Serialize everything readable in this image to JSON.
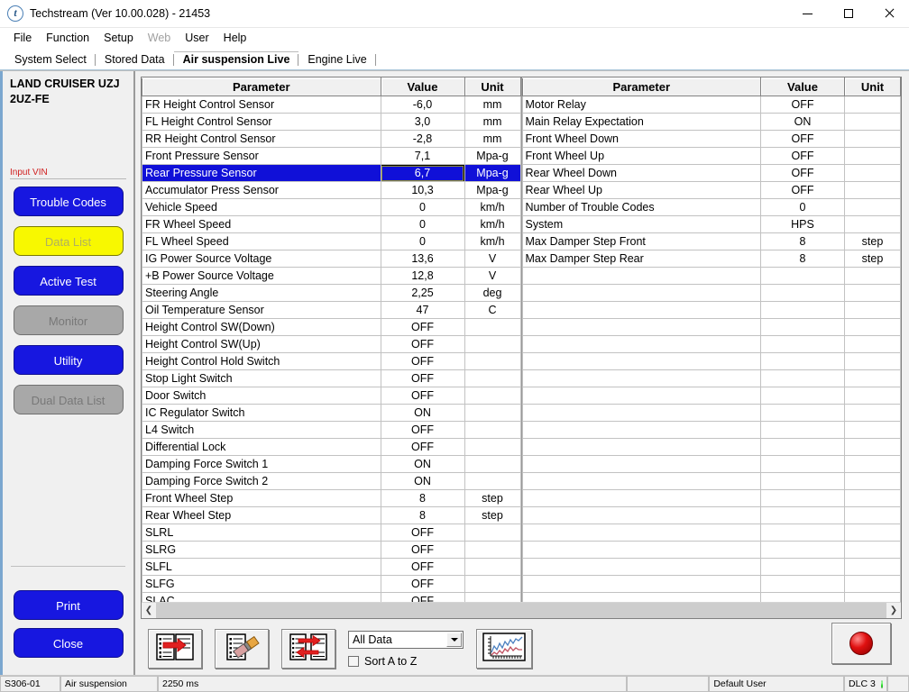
{
  "window": {
    "title": "Techstream (Ver 10.00.028) - 21453",
    "app_icon": "techstream-logo-icon",
    "minimize": "minimize-icon",
    "maximize": "maximize-icon",
    "close": "close-icon"
  },
  "menu": [
    {
      "label": "File",
      "disabled": false
    },
    {
      "label": "Function",
      "disabled": false
    },
    {
      "label": "Setup",
      "disabled": false
    },
    {
      "label": "Web",
      "disabled": true
    },
    {
      "label": "User",
      "disabled": false
    },
    {
      "label": "Help",
      "disabled": false
    }
  ],
  "tabs": [
    {
      "label": "System Select",
      "active": false
    },
    {
      "label": "Stored Data",
      "active": false
    },
    {
      "label": "Air suspension Live",
      "active": true
    },
    {
      "label": "Engine Live",
      "active": false
    }
  ],
  "sidebar": {
    "vehicle_line1": "LAND CRUISER UZJ",
    "vehicle_line2": "2UZ-FE",
    "vin_label": "Input VIN",
    "buttons": [
      {
        "label": "Trouble Codes",
        "style": "blue"
      },
      {
        "label": "Data List",
        "style": "yellow"
      },
      {
        "label": "Active Test",
        "style": "blue"
      },
      {
        "label": "Monitor",
        "style": "gray"
      },
      {
        "label": "Utility",
        "style": "blue"
      },
      {
        "label": "Dual Data List",
        "style": "gray"
      }
    ],
    "bottom_buttons": [
      {
        "label": "Print",
        "style": "blue"
      },
      {
        "label": "Close",
        "style": "blue"
      }
    ]
  },
  "grid": {
    "headers": {
      "parameter": "Parameter",
      "value": "Value",
      "unit": "Unit"
    },
    "left_rows": [
      {
        "parameter": "FR Height Control Sensor",
        "value": "-6,0",
        "unit": "mm",
        "selected": false
      },
      {
        "parameter": "FL Height Control Sensor",
        "value": "3,0",
        "unit": "mm",
        "selected": false
      },
      {
        "parameter": "RR Height Control Sensor",
        "value": "-2,8",
        "unit": "mm",
        "selected": false
      },
      {
        "parameter": "Front Pressure Sensor",
        "value": "7,1",
        "unit": "Mpa-g",
        "selected": false
      },
      {
        "parameter": "Rear Pressure Sensor",
        "value": "6,7",
        "unit": "Mpa-g",
        "selected": true
      },
      {
        "parameter": "Accumulator Press Sensor",
        "value": "10,3",
        "unit": "Mpa-g",
        "selected": false
      },
      {
        "parameter": "Vehicle Speed",
        "value": "0",
        "unit": "km/h",
        "selected": false
      },
      {
        "parameter": "FR Wheel Speed",
        "value": "0",
        "unit": "km/h",
        "selected": false
      },
      {
        "parameter": "FL Wheel Speed",
        "value": "0",
        "unit": "km/h",
        "selected": false
      },
      {
        "parameter": "IG Power Source Voltage",
        "value": "13,6",
        "unit": "V",
        "selected": false
      },
      {
        "parameter": "+B Power Source Voltage",
        "value": "12,8",
        "unit": "V",
        "selected": false
      },
      {
        "parameter": "Steering Angle",
        "value": "2,25",
        "unit": "deg",
        "selected": false
      },
      {
        "parameter": "Oil Temperature Sensor",
        "value": "47",
        "unit": "C",
        "selected": false
      },
      {
        "parameter": "Height Control SW(Down)",
        "value": "OFF",
        "unit": "",
        "selected": false
      },
      {
        "parameter": "Height Control SW(Up)",
        "value": "OFF",
        "unit": "",
        "selected": false
      },
      {
        "parameter": "Height Control Hold Switch",
        "value": "OFF",
        "unit": "",
        "selected": false
      },
      {
        "parameter": "Stop Light Switch",
        "value": "OFF",
        "unit": "",
        "selected": false
      },
      {
        "parameter": "Door Switch",
        "value": "OFF",
        "unit": "",
        "selected": false
      },
      {
        "parameter": "IC Regulator Switch",
        "value": "ON",
        "unit": "",
        "selected": false
      },
      {
        "parameter": "L4 Switch",
        "value": "OFF",
        "unit": "",
        "selected": false
      },
      {
        "parameter": "Differential Lock",
        "value": "OFF",
        "unit": "",
        "selected": false
      },
      {
        "parameter": "Damping Force Switch 1",
        "value": "ON",
        "unit": "",
        "selected": false
      },
      {
        "parameter": "Damping Force Switch 2",
        "value": "ON",
        "unit": "",
        "selected": false
      },
      {
        "parameter": "Front Wheel Step",
        "value": "8",
        "unit": "step",
        "selected": false
      },
      {
        "parameter": "Rear Wheel Step",
        "value": "8",
        "unit": "step",
        "selected": false
      },
      {
        "parameter": "SLRL",
        "value": "OFF",
        "unit": "",
        "selected": false
      },
      {
        "parameter": "SLRG",
        "value": "OFF",
        "unit": "",
        "selected": false
      },
      {
        "parameter": "SLFL",
        "value": "OFF",
        "unit": "",
        "selected": false
      },
      {
        "parameter": "SLFG",
        "value": "OFF",
        "unit": "",
        "selected": false
      },
      {
        "parameter": "SLAC",
        "value": "OFF",
        "unit": "",
        "selected": false
      }
    ],
    "right_rows": [
      {
        "parameter": "Motor Relay",
        "value": "OFF",
        "unit": "",
        "selected": false
      },
      {
        "parameter": "Main Relay Expectation",
        "value": "ON",
        "unit": "",
        "selected": false
      },
      {
        "parameter": "Front Wheel Down",
        "value": "OFF",
        "unit": "",
        "selected": false
      },
      {
        "parameter": "Front Wheel Up",
        "value": "OFF",
        "unit": "",
        "selected": false
      },
      {
        "parameter": "Rear Wheel Down",
        "value": "OFF",
        "unit": "",
        "selected": false
      },
      {
        "parameter": "Rear Wheel Up",
        "value": "OFF",
        "unit": "",
        "selected": false
      },
      {
        "parameter": "Number of Trouble Codes",
        "value": "0",
        "unit": "",
        "selected": false
      },
      {
        "parameter": "System",
        "value": "HPS",
        "unit": "",
        "selected": false
      },
      {
        "parameter": "Max Damper Step Front",
        "value": "8",
        "unit": "step",
        "selected": false
      },
      {
        "parameter": "Max Damper Step Rear",
        "value": "8",
        "unit": "step",
        "selected": false
      },
      {
        "parameter": "",
        "value": "",
        "unit": "",
        "selected": false
      },
      {
        "parameter": "",
        "value": "",
        "unit": "",
        "selected": false
      },
      {
        "parameter": "",
        "value": "",
        "unit": "",
        "selected": false
      },
      {
        "parameter": "",
        "value": "",
        "unit": "",
        "selected": false
      },
      {
        "parameter": "",
        "value": "",
        "unit": "",
        "selected": false
      },
      {
        "parameter": "",
        "value": "",
        "unit": "",
        "selected": false
      },
      {
        "parameter": "",
        "value": "",
        "unit": "",
        "selected": false
      },
      {
        "parameter": "",
        "value": "",
        "unit": "",
        "selected": false
      },
      {
        "parameter": "",
        "value": "",
        "unit": "",
        "selected": false
      },
      {
        "parameter": "",
        "value": "",
        "unit": "",
        "selected": false
      },
      {
        "parameter": "",
        "value": "",
        "unit": "",
        "selected": false
      },
      {
        "parameter": "",
        "value": "",
        "unit": "",
        "selected": false
      },
      {
        "parameter": "",
        "value": "",
        "unit": "",
        "selected": false
      },
      {
        "parameter": "",
        "value": "",
        "unit": "",
        "selected": false
      },
      {
        "parameter": "",
        "value": "",
        "unit": "",
        "selected": false
      },
      {
        "parameter": "",
        "value": "",
        "unit": "",
        "selected": false
      },
      {
        "parameter": "",
        "value": "",
        "unit": "",
        "selected": false
      },
      {
        "parameter": "",
        "value": "",
        "unit": "",
        "selected": false
      },
      {
        "parameter": "",
        "value": "",
        "unit": "",
        "selected": false
      },
      {
        "parameter": "",
        "value": "",
        "unit": "",
        "selected": false
      }
    ],
    "scroll_left_icon": "chevron-left-icon",
    "scroll_right_icon": "chevron-right-icon"
  },
  "toolbar": {
    "buttons": [
      {
        "icon": "save-snapshot-icon",
        "label": ""
      },
      {
        "icon": "erase-icon",
        "label": ""
      },
      {
        "icon": "swap-data-icon",
        "label": ""
      }
    ],
    "filter": {
      "selected": "All Data",
      "options": [
        "All Data"
      ],
      "dropdown_icon": "chevron-down-icon"
    },
    "sort_checkbox": {
      "label": "Sort A to Z",
      "checked": false
    },
    "graph_button": {
      "icon": "graph-icon"
    },
    "record_button": {
      "icon": "record-icon"
    }
  },
  "statusbar": {
    "code": "S306-01",
    "system": "Air suspension",
    "rate": "2250 ms",
    "blank": "",
    "user": "Default User",
    "dlc": "DLC 3",
    "led_color": "#12cc12"
  },
  "colors": {
    "accent_blue": "#1717e0",
    "selection_blue": "#1010d8",
    "highlight_yellow": "#f8f800",
    "disabled_gray": "#a8a8a8",
    "vin_red": "#d02020"
  }
}
